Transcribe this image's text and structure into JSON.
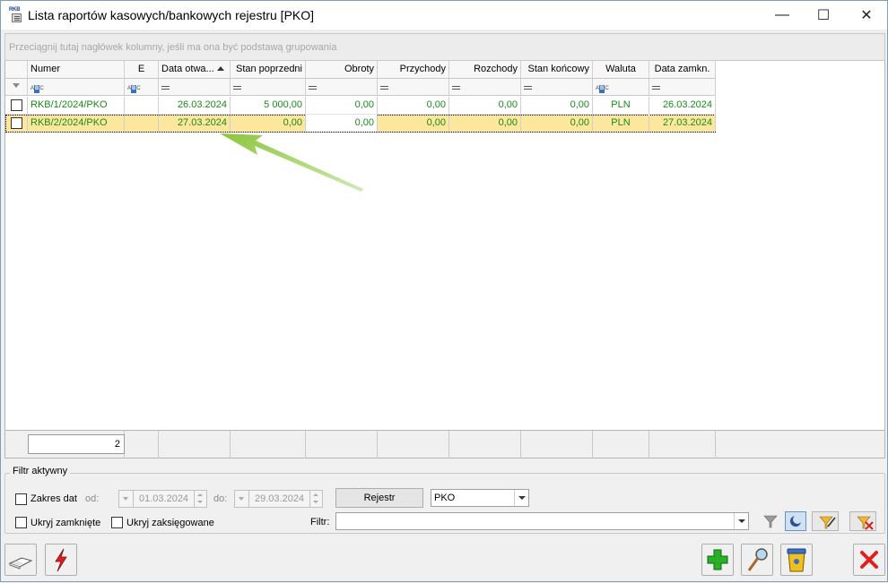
{
  "window": {
    "title": "Lista raportów kasowych/bankowych rejestru [PKO]",
    "app_icon_text": "RKB",
    "minimize_glyph": "—",
    "maximize_glyph": "☐",
    "close_glyph": "✕"
  },
  "group_area": {
    "hint": "Przeciągnij tutaj nagłówek kolumny, jeśli ma ona być podstawą grupowania"
  },
  "grid": {
    "columns": [
      {
        "label": "Numer"
      },
      {
        "label": "E"
      },
      {
        "label": "Data otwa..."
      },
      {
        "label": "Stan poprzedni"
      },
      {
        "label": "Obroty"
      },
      {
        "label": "Przychody"
      },
      {
        "label": "Rozchody"
      },
      {
        "label": "Stan końcowy"
      },
      {
        "label": "Waluta"
      },
      {
        "label": "Data zamkn."
      }
    ],
    "filter_row": {
      "abc_text": "ABC",
      "abc_highlight": "B"
    },
    "rows": [
      {
        "numer": "RKB/1/2024/PKO",
        "e": "",
        "data_otwarcia": "26.03.2024",
        "stan_poprzedni": "5 000,00",
        "obroty": "0,00",
        "przychody": "0,00",
        "rozchody": "0,00",
        "stan_koncowy": "0,00",
        "waluta": "PLN",
        "data_zamkniecia": "26.03.2024"
      },
      {
        "numer": "RKB/2/2024/PKO",
        "e": "",
        "data_otwarcia": "27.03.2024",
        "stan_poprzedni": "0,00",
        "obroty": "0,00",
        "przychody": "0,00",
        "rozchody": "0,00",
        "stan_koncowy": "0,00",
        "waluta": "PLN",
        "data_zamkniecia": "27.03.2024"
      }
    ],
    "footer": {
      "count": "2"
    }
  },
  "filter": {
    "legend": "Filtr aktywny",
    "zakres_dat_label": "Zakres dat",
    "od_label": "od:",
    "od_value": "01.03.2024",
    "do_label": "do:",
    "do_value": "29.03.2024",
    "rejestr_button": "Rejestr",
    "rejestr_value": "PKO",
    "ukryj_zamkniete_label": "Ukryj zamknięte",
    "ukryj_zaksiegowane_label": "Ukryj zaksięgowane",
    "filtr_label": "Filtr:",
    "filtr_value": ""
  },
  "colors": {
    "row_text": "#1a8a1a",
    "selected_row": "#fde79d",
    "arrow": "#8cc63f"
  }
}
